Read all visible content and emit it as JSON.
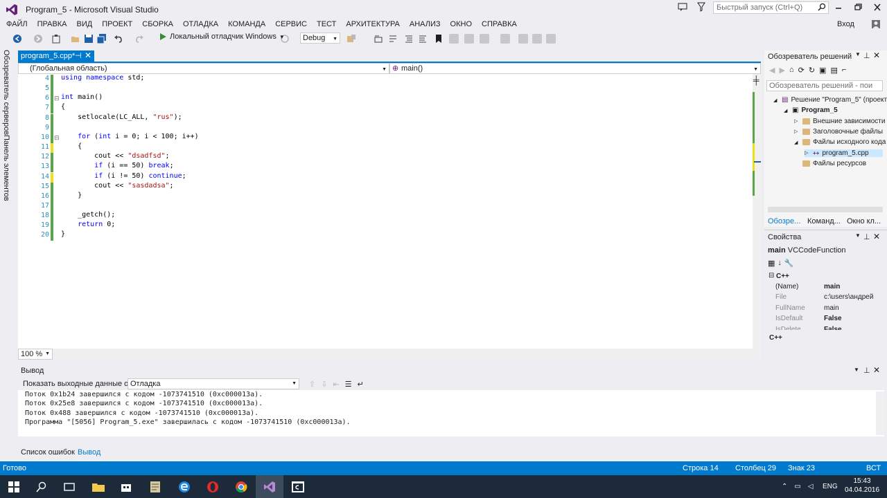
{
  "window": {
    "title": "Program_5 - Microsoft Visual Studio",
    "quick_launch_placeholder": "Быстрый запуск (Ctrl+Q)",
    "sign_in": "Вход"
  },
  "menu": [
    "ФАЙЛ",
    "ПРАВКА",
    "ВИД",
    "ПРОЕКТ",
    "СБОРКА",
    "ОТЛАДКА",
    "КОМАНДА",
    "СЕРВИС",
    "ТЕСТ",
    "АРХИТЕКТУРА",
    "АНАЛИЗ",
    "ОКНО",
    "СПРАВКА"
  ],
  "toolbar": {
    "run_label": "Локальный отладчик Windows",
    "config": "Debug"
  },
  "left_strip": [
    "Обозреватель серверов",
    "Панель элементов"
  ],
  "editor": {
    "tab_title": "program_5.cpp*",
    "scope": "(Глобальная область)",
    "function": "main()",
    "zoom": "100 %",
    "lines": [
      {
        "n": "4",
        "code": [
          {
            "t": "using namespace ",
            "c": "kw"
          },
          {
            "t": "std;"
          }
        ]
      },
      {
        "n": "5",
        "code": []
      },
      {
        "n": "6",
        "code": [
          {
            "t": "int ",
            "c": "kw"
          },
          {
            "t": "main()"
          }
        ]
      },
      {
        "n": "7",
        "code": [
          {
            "t": "{"
          }
        ]
      },
      {
        "n": "8",
        "code": [
          {
            "t": "    setlocale(LC_ALL, "
          },
          {
            "t": "\"rus\"",
            "c": "str"
          },
          {
            "t": ");"
          }
        ]
      },
      {
        "n": "9",
        "code": []
      },
      {
        "n": "10",
        "code": [
          {
            "t": "    "
          },
          {
            "t": "for",
            "c": "kw"
          },
          {
            "t": " ("
          },
          {
            "t": "int",
            "c": "kw"
          },
          {
            "t": " i = 0; i < 100; i++)"
          }
        ]
      },
      {
        "n": "11",
        "code": [
          {
            "t": "    {"
          }
        ]
      },
      {
        "n": "12",
        "code": [
          {
            "t": "        cout << "
          },
          {
            "t": "\"dsadfsd\"",
            "c": "str"
          },
          {
            "t": ";"
          }
        ]
      },
      {
        "n": "13",
        "code": [
          {
            "t": "        "
          },
          {
            "t": "if",
            "c": "kw"
          },
          {
            "t": " (i == 50) "
          },
          {
            "t": "break",
            "c": "kw"
          },
          {
            "t": ";"
          }
        ]
      },
      {
        "n": "14",
        "code": [
          {
            "t": "        "
          },
          {
            "t": "if",
            "c": "kw"
          },
          {
            "t": " (i != 50) "
          },
          {
            "t": "continue",
            "c": "kw"
          },
          {
            "t": ";"
          }
        ]
      },
      {
        "n": "15",
        "code": [
          {
            "t": "        cout << "
          },
          {
            "t": "\"sasdadsa\"",
            "c": "str"
          },
          {
            "t": ";"
          }
        ]
      },
      {
        "n": "16",
        "code": [
          {
            "t": "    }"
          }
        ]
      },
      {
        "n": "17",
        "code": []
      },
      {
        "n": "18",
        "code": [
          {
            "t": "    _getch();"
          }
        ]
      },
      {
        "n": "19",
        "code": [
          {
            "t": "    "
          },
          {
            "t": "return",
            "c": "kw"
          },
          {
            "t": " 0;"
          }
        ]
      },
      {
        "n": "20",
        "code": [
          {
            "t": "}"
          }
        ]
      }
    ]
  },
  "solution_explorer": {
    "title": "Обозреватель решений",
    "search_placeholder": "Обозреватель решений - пои",
    "items": [
      {
        "label": "Решение \"Program_5\" (проекта",
        "level": 0,
        "kind": "solution"
      },
      {
        "label": "Program_5",
        "level": 1,
        "kind": "project"
      },
      {
        "label": "Внешние зависимости",
        "level": 2,
        "kind": "folder"
      },
      {
        "label": "Заголовочные файлы",
        "level": 2,
        "kind": "folder"
      },
      {
        "label": "Файлы исходного кода",
        "level": 2,
        "kind": "folder"
      },
      {
        "label": "program_5.cpp",
        "level": 3,
        "kind": "file"
      },
      {
        "label": "Файлы ресурсов",
        "level": 2,
        "kind": "folder"
      }
    ],
    "bottom_tabs": [
      "Обозре...",
      "Команд...",
      "Окно кл..."
    ]
  },
  "properties": {
    "title": "Свойства",
    "object_name": "main",
    "object_type": "VCCodeFunction",
    "category": "C++",
    "rows": [
      {
        "name": "(Name)",
        "value": "main"
      },
      {
        "name": "File",
        "value": "c:\\users\\андрей"
      },
      {
        "name": "FullName",
        "value": "main"
      },
      {
        "name": "IsDefault",
        "value": "False"
      },
      {
        "name": "IsDelete",
        "value": "False"
      }
    ],
    "footer_category": "C++"
  },
  "output": {
    "title": "Вывод",
    "show_label": "Показать выходные данные от:",
    "source": "Отладка",
    "lines": [
      "Поток 0x1b24 завершился с кодом -1073741510 (0xc000013a).",
      "Поток 0x25e8 завершился с кодом -1073741510 (0xc000013a).",
      "Поток 0x488 завершился с кодом -1073741510 (0xc000013a).",
      "Программа \"[5056] Program_5.exe\" завершилась с кодом -1073741510 (0xc000013a)."
    ],
    "tabs": [
      "Список ошибок",
      "Вывод"
    ]
  },
  "status": {
    "ready": "Готово",
    "line": "Строка 14",
    "col": "Столбец 29",
    "ch": "Знак 23",
    "mode": "ВСТ"
  },
  "taskbar": {
    "lang": "ENG",
    "time": "15:43",
    "date": "04.04.2016"
  },
  "colors": {
    "accent": "#007acc",
    "changed_saved": "#57a64a",
    "changed_unsaved": "#efe01e"
  }
}
